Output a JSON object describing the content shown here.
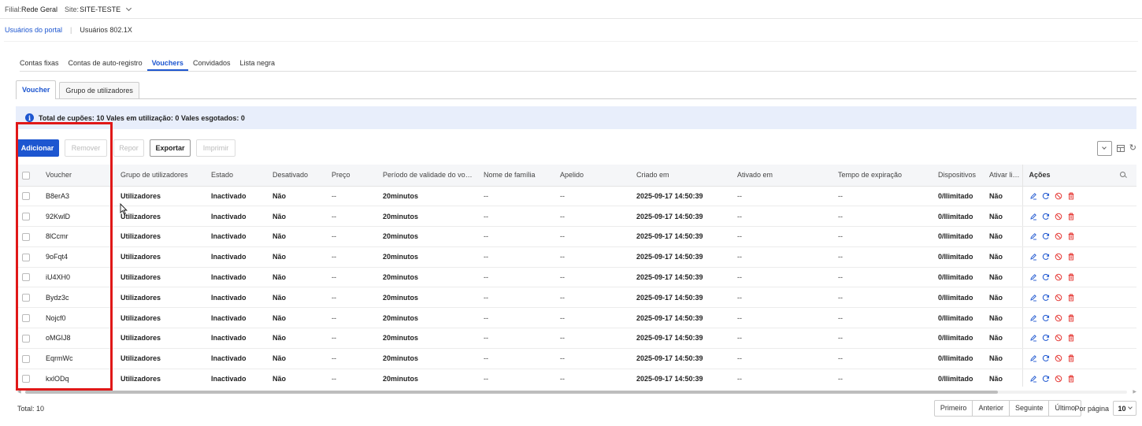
{
  "topbar": {
    "filial_label": "Filial:",
    "filial_value": "Rede Geral",
    "site_label": "Site:",
    "site_value": "SITE-TESTE"
  },
  "subnav": {
    "portal_users": "Usuários do portal",
    "separator": "|",
    "dot1x_users": "Usuários 802.1X"
  },
  "main_tabs": [
    {
      "label": "Contas fixas"
    },
    {
      "label": "Contas de auto-registro"
    },
    {
      "label": "Vouchers",
      "active": true
    },
    {
      "label": "Convidados"
    },
    {
      "label": "Lista negra"
    }
  ],
  "sub_tabs": [
    {
      "label": "Voucher",
      "active": true
    },
    {
      "label": "Grupo de utilizadores"
    }
  ],
  "info_text": "Total de cupões: 10  Vales em utilização: 0  Vales esgotados: 0",
  "toolbar": {
    "add": "Adicionar",
    "remove": "Remover",
    "reset": "Repor",
    "export": "Exportar",
    "print": "Imprimir"
  },
  "columns": {
    "voucher": "Voucher",
    "group": "Grupo de utilizadores",
    "status": "Estado",
    "disabled": "Desativado",
    "price": "Preço",
    "validity": "Período de validade do vo…",
    "family_name": "Nome de família",
    "nickname": "Apelido",
    "created": "Criado em",
    "activated": "Ativado em",
    "expiration": "Tempo de expiração",
    "devices": "Dispositivos",
    "activate_link": "Ativar ligaçã",
    "actions": "Ações"
  },
  "rows": [
    {
      "voucher": "B8erA3",
      "group": "Utilizadores",
      "status": "Inactivado",
      "disabled": "Não",
      "price": "--",
      "validity": "20minutos",
      "family_name": "--",
      "nickname": "--",
      "created": "2025-09-17 14:50:39",
      "activated": "--",
      "expiration": "--",
      "devices": "0/Ilimitado",
      "activate_link": "Não"
    },
    {
      "voucher": "92KwlD",
      "group": "Utilizadores",
      "status": "Inactivado",
      "disabled": "Não",
      "price": "--",
      "validity": "20minutos",
      "family_name": "--",
      "nickname": "--",
      "created": "2025-09-17 14:50:39",
      "activated": "--",
      "expiration": "--",
      "devices": "0/Ilimitado",
      "activate_link": "Não"
    },
    {
      "voucher": "8lCcmr",
      "group": "Utilizadores",
      "status": "Inactivado",
      "disabled": "Não",
      "price": "--",
      "validity": "20minutos",
      "family_name": "--",
      "nickname": "--",
      "created": "2025-09-17 14:50:39",
      "activated": "--",
      "expiration": "--",
      "devices": "0/Ilimitado",
      "activate_link": "Não"
    },
    {
      "voucher": "9oFqt4",
      "group": "Utilizadores",
      "status": "Inactivado",
      "disabled": "Não",
      "price": "--",
      "validity": "20minutos",
      "family_name": "--",
      "nickname": "--",
      "created": "2025-09-17 14:50:39",
      "activated": "--",
      "expiration": "--",
      "devices": "0/Ilimitado",
      "activate_link": "Não"
    },
    {
      "voucher": "iU4XH0",
      "group": "Utilizadores",
      "status": "Inactivado",
      "disabled": "Não",
      "price": "--",
      "validity": "20minutos",
      "family_name": "--",
      "nickname": "--",
      "created": "2025-09-17 14:50:39",
      "activated": "--",
      "expiration": "--",
      "devices": "0/Ilimitado",
      "activate_link": "Não"
    },
    {
      "voucher": "Bydz3c",
      "group": "Utilizadores",
      "status": "Inactivado",
      "disabled": "Não",
      "price": "--",
      "validity": "20minutos",
      "family_name": "--",
      "nickname": "--",
      "created": "2025-09-17 14:50:39",
      "activated": "--",
      "expiration": "--",
      "devices": "0/Ilimitado",
      "activate_link": "Não"
    },
    {
      "voucher": "Nojcf0",
      "group": "Utilizadores",
      "status": "Inactivado",
      "disabled": "Não",
      "price": "--",
      "validity": "20minutos",
      "family_name": "--",
      "nickname": "--",
      "created": "2025-09-17 14:50:39",
      "activated": "--",
      "expiration": "--",
      "devices": "0/Ilimitado",
      "activate_link": "Não"
    },
    {
      "voucher": "oMGIJ8",
      "group": "Utilizadores",
      "status": "Inactivado",
      "disabled": "Não",
      "price": "--",
      "validity": "20minutos",
      "family_name": "--",
      "nickname": "--",
      "created": "2025-09-17 14:50:39",
      "activated": "--",
      "expiration": "--",
      "devices": "0/Ilimitado",
      "activate_link": "Não"
    },
    {
      "voucher": "EqrmWc",
      "group": "Utilizadores",
      "status": "Inactivado",
      "disabled": "Não",
      "price": "--",
      "validity": "20minutos",
      "family_name": "--",
      "nickname": "--",
      "created": "2025-09-17 14:50:39",
      "activated": "--",
      "expiration": "--",
      "devices": "0/Ilimitado",
      "activate_link": "Não"
    },
    {
      "voucher": "kxlODq",
      "group": "Utilizadores",
      "status": "Inactivado",
      "disabled": "Não",
      "price": "--",
      "validity": "20minutos",
      "family_name": "--",
      "nickname": "--",
      "created": "2025-09-17 14:50:39",
      "activated": "--",
      "expiration": "--",
      "devices": "0/Ilimitado",
      "activate_link": "Não"
    }
  ],
  "row_action_icons": [
    "edit-icon",
    "reset-icon",
    "disable-icon",
    "delete-icon"
  ],
  "footer": {
    "total": "Total: 10",
    "first": "Primeiro",
    "prev": "Anterior",
    "next": "Seguinte",
    "last": "Último",
    "per_page_label": "Por página",
    "per_page_value": "10"
  },
  "colors": {
    "accent": "#1d56d0",
    "info_bg": "#e8eefb",
    "highlight": "#e01818",
    "danger": "#e53935"
  }
}
